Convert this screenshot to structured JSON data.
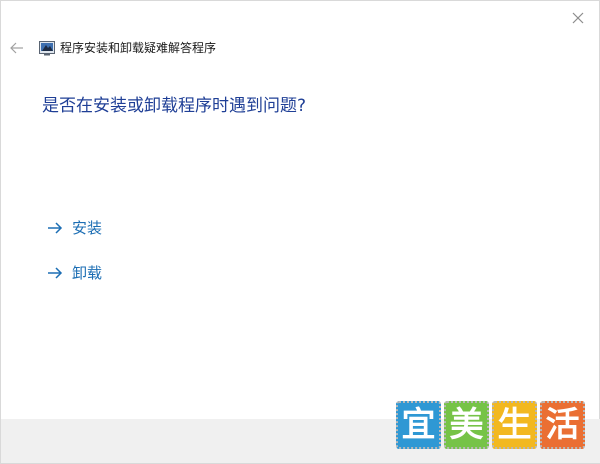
{
  "window": {
    "title": "程序安装和卸载疑难解答程序"
  },
  "heading": "是否在安装或卸载程序时遇到问题?",
  "options": [
    {
      "label": "安装"
    },
    {
      "label": "卸载"
    }
  ],
  "watermark": {
    "chars": [
      "宜",
      "美",
      "生",
      "活"
    ],
    "colors": [
      "#2f98d4",
      "#76c347",
      "#f2b820",
      "#ea6f33"
    ]
  },
  "colors": {
    "heading": "#1f3f96",
    "link": "#1c6eb4",
    "footer": "#f0f0f0"
  },
  "icons": {
    "close": "close-icon",
    "back": "back-arrow-icon",
    "app": "troubleshooter-icon",
    "option_arrow": "arrow-right-icon"
  }
}
